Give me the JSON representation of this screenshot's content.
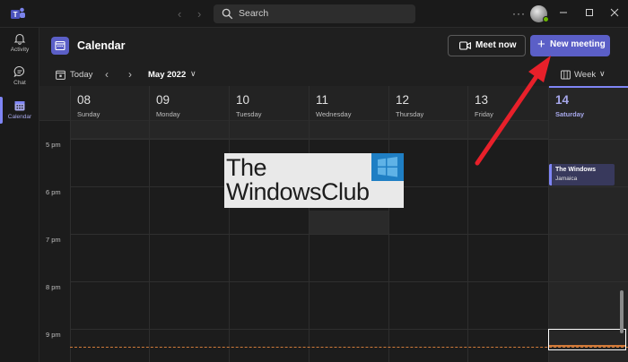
{
  "titlebar": {
    "search_label": "Search"
  },
  "rail": {
    "items": [
      {
        "label": "Activity",
        "icon": "bell-icon"
      },
      {
        "label": "Chat",
        "icon": "chat-icon"
      },
      {
        "label": "Calendar",
        "icon": "calendar-icon"
      }
    ]
  },
  "header": {
    "title": "Calendar",
    "meet_now_label": "Meet now",
    "new_meeting_label": "New meeting"
  },
  "toolbar": {
    "today_label": "Today",
    "month_label": "May 2022",
    "view_label": "Week"
  },
  "days": [
    {
      "num": "08",
      "name": "Sunday"
    },
    {
      "num": "09",
      "name": "Monday"
    },
    {
      "num": "10",
      "name": "Tuesday"
    },
    {
      "num": "11",
      "name": "Wednesday"
    },
    {
      "num": "12",
      "name": "Thursday"
    },
    {
      "num": "13",
      "name": "Friday"
    },
    {
      "num": "14",
      "name": "Saturday",
      "today": true
    }
  ],
  "times": [
    "5 pm",
    "6 pm",
    "7 pm",
    "8 pm",
    "9 pm"
  ],
  "event": {
    "title": "The Windows",
    "subtitle": "Jamaica"
  },
  "watermark": {
    "line1": "The",
    "line2": "WindowsClub"
  },
  "colors": {
    "accent": "#5b5fc7",
    "today_accent": "#7f85f5",
    "annotation_arrow": "#e8202a",
    "current_time": "#d07a3a"
  }
}
